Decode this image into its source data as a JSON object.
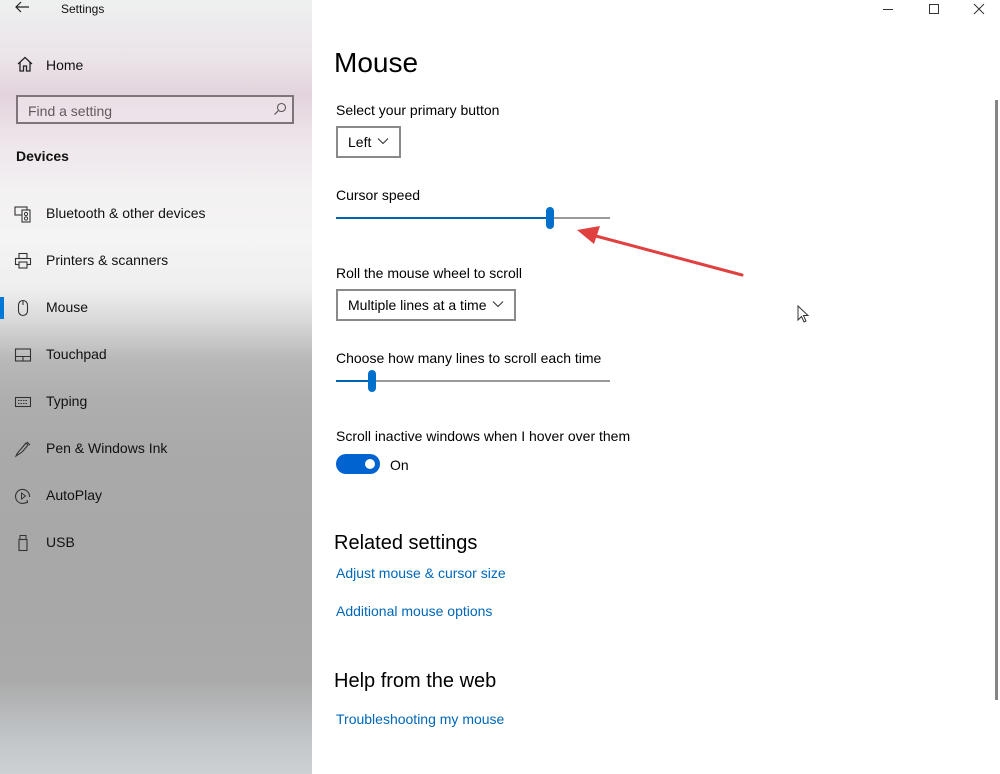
{
  "window": {
    "title": "Settings",
    "back_icon": "arrow-left-icon",
    "controls": [
      {
        "name": "minimize",
        "icon": "minimize-icon"
      },
      {
        "name": "maximize",
        "icon": "maximize-icon"
      },
      {
        "name": "close",
        "icon": "close-icon"
      }
    ]
  },
  "sidebar": {
    "home": {
      "label": "Home",
      "icon": "home-icon"
    },
    "search": {
      "placeholder": "Find a setting",
      "value": "",
      "icon": "search-icon"
    },
    "section": "Devices",
    "items": [
      {
        "label": "Bluetooth & other devices",
        "icon": "bluetooth-devices-icon",
        "selected": false
      },
      {
        "label": "Printers & scanners",
        "icon": "printer-icon",
        "selected": false
      },
      {
        "label": "Mouse",
        "icon": "mouse-icon",
        "selected": true
      },
      {
        "label": "Touchpad",
        "icon": "touchpad-icon",
        "selected": false
      },
      {
        "label": "Typing",
        "icon": "keyboard-icon",
        "selected": false
      },
      {
        "label": "Pen & Windows Ink",
        "icon": "pen-icon",
        "selected": false
      },
      {
        "label": "AutoPlay",
        "icon": "autoplay-icon",
        "selected": false
      },
      {
        "label": "USB",
        "icon": "usb-icon",
        "selected": false
      }
    ]
  },
  "main": {
    "title": "Mouse",
    "primary_button": {
      "label": "Select your primary button",
      "value": "Left"
    },
    "cursor_speed": {
      "label": "Cursor speed",
      "value_fraction": 0.78
    },
    "wheel_scroll": {
      "label": "Roll the mouse wheel to scroll",
      "value": "Multiple lines at a time"
    },
    "lines_to_scroll": {
      "label": "Choose how many lines to scroll each time",
      "value_fraction": 0.13
    },
    "inactive_scroll": {
      "label": "Scroll inactive windows when I hover over them",
      "state": "On",
      "on": true
    },
    "related": {
      "heading": "Related settings",
      "links": [
        "Adjust mouse & cursor size",
        "Additional mouse options"
      ]
    },
    "help": {
      "heading": "Help from the web",
      "links": [
        "Troubleshooting my mouse"
      ]
    }
  },
  "colors": {
    "accent": "#0078d7",
    "link": "#0067b8",
    "annotation_arrow": "#e04040"
  }
}
